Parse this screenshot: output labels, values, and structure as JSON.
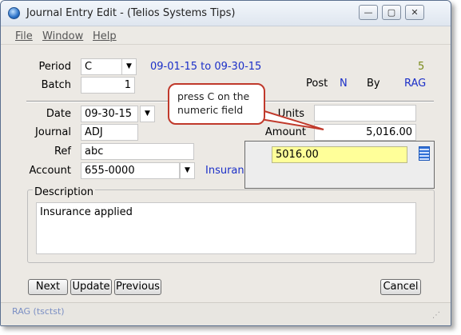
{
  "window": {
    "title": "Journal Entry Edit - (Telios Systems Tips)",
    "controls": [
      "—",
      "▢",
      "✕"
    ]
  },
  "menu": [
    "File",
    "Window",
    "Help"
  ],
  "header": {
    "period_label": "Period",
    "period_value": "C",
    "period_range": "09-01-15 to 09-30-15",
    "period_number": "5",
    "batch_label": "Batch",
    "batch_value": "1",
    "post_label": "Post",
    "post_value": "N",
    "by_label": "By",
    "by_value": "RAG"
  },
  "entry": {
    "date_label": "Date",
    "date_value": "09-30-15",
    "journal_label": "Journal",
    "journal_value": "ADJ",
    "ref_label": "Ref",
    "ref_value": "abc",
    "account_label": "Account",
    "account_value": "655-0000",
    "account_desc": "Insurance",
    "units_label": "Units",
    "units_value": "",
    "amount_label": "Amount",
    "amount_value": "5,016.00",
    "description_label": "Description",
    "description_value": "Insurance applied"
  },
  "popup": {
    "value": "5016.00",
    "icon": "calculator-icon"
  },
  "callout": {
    "line1": "press C on the",
    "line2": "numeric field"
  },
  "buttons": {
    "next": "Next",
    "update": "Update",
    "previous": "Previous",
    "cancel": "Cancel"
  },
  "status": {
    "user": "RAG (tsctst)"
  },
  "colors": {
    "link_blue": "#1b2fc8",
    "period_number": "#7a8a1a",
    "popup_field": "#ffff99",
    "callout_border": "#c0392b"
  }
}
